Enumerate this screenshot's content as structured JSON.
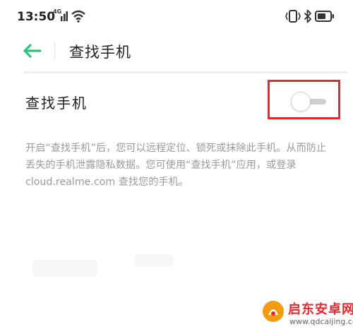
{
  "status_bar": {
    "time": "13:50",
    "network_label": "4G"
  },
  "header": {
    "title": "查找手机",
    "back_icon": "arrow-left-icon",
    "accent_color": "#2ec27e"
  },
  "setting": {
    "label": "查找手机",
    "toggle_state": "off",
    "highlight_color": "#e8262e"
  },
  "description": "开启“查找手机”后，您可以远程定位、锁死或抹除此手机。从而防止丢失的手机泄露隐私数据。您可使用“查找手机”应用，或登录 cloud.realme.com 查找您的手机。",
  "watermark": {
    "title": "启东安卓网",
    "url": "www.qdcaijing.com"
  }
}
